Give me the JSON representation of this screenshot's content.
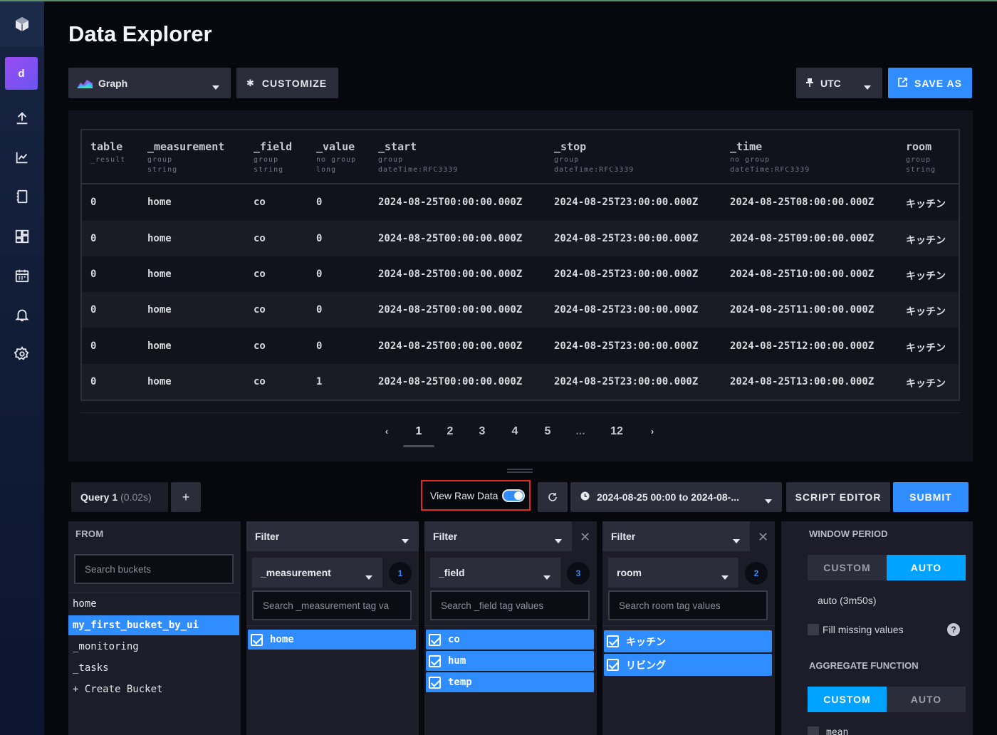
{
  "page": {
    "title": "Data Explorer"
  },
  "sidebar": {
    "org_initial": "d",
    "icons": [
      "upload-icon",
      "chart-icon",
      "notebook-icon",
      "dashboards-icon",
      "tasks-calendar-icon",
      "alerts-bell-icon",
      "settings-gear-icon"
    ]
  },
  "toolbar": {
    "graph_label": "Graph",
    "customize_label": "CUSTOMIZE",
    "timezone_label": "UTC",
    "save_as_label": "SAVE AS"
  },
  "table": {
    "columns": [
      {
        "name": "table",
        "sub1": "_result",
        "sub2": ""
      },
      {
        "name": "_measurement",
        "sub1": "group",
        "sub2": "string"
      },
      {
        "name": "_field",
        "sub1": "group",
        "sub2": "string"
      },
      {
        "name": "_value",
        "sub1": "no group",
        "sub2": "long"
      },
      {
        "name": "_start",
        "sub1": "group",
        "sub2": "dateTime:RFC3339"
      },
      {
        "name": "_stop",
        "sub1": "group",
        "sub2": "dateTime:RFC3339"
      },
      {
        "name": "_time",
        "sub1": "no group",
        "sub2": "dateTime:RFC3339"
      },
      {
        "name": "room",
        "sub1": "group",
        "sub2": "string"
      }
    ],
    "rows": [
      [
        "0",
        "home",
        "co",
        "0",
        "2024-08-25T00:00:00.000Z",
        "2024-08-25T23:00:00.000Z",
        "2024-08-25T08:00:00.000Z",
        "キッチン"
      ],
      [
        "0",
        "home",
        "co",
        "0",
        "2024-08-25T00:00:00.000Z",
        "2024-08-25T23:00:00.000Z",
        "2024-08-25T09:00:00.000Z",
        "キッチン"
      ],
      [
        "0",
        "home",
        "co",
        "0",
        "2024-08-25T00:00:00.000Z",
        "2024-08-25T23:00:00.000Z",
        "2024-08-25T10:00:00.000Z",
        "キッチン"
      ],
      [
        "0",
        "home",
        "co",
        "0",
        "2024-08-25T00:00:00.000Z",
        "2024-08-25T23:00:00.000Z",
        "2024-08-25T11:00:00.000Z",
        "キッチン"
      ],
      [
        "0",
        "home",
        "co",
        "0",
        "2024-08-25T00:00:00.000Z",
        "2024-08-25T23:00:00.000Z",
        "2024-08-25T12:00:00.000Z",
        "キッチン"
      ],
      [
        "0",
        "home",
        "co",
        "1",
        "2024-08-25T00:00:00.000Z",
        "2024-08-25T23:00:00.000Z",
        "2024-08-25T13:00:00.000Z",
        "キッチン"
      ]
    ]
  },
  "pagination": {
    "prev": "‹",
    "pages": [
      "1",
      "2",
      "3",
      "4",
      "5"
    ],
    "ellipsis": "...",
    "last": "12",
    "next": "›",
    "current": "1"
  },
  "query_bar": {
    "query_tab_label": "Query 1",
    "query_tab_time": "(0.02s)",
    "add_query": "+",
    "view_raw_label": "View Raw Data",
    "view_raw_on": true,
    "time_range": "2024-08-25 00:00 to 2024-08-...",
    "script_editor_label": "SCRIPT EDITOR",
    "submit_label": "SUBMIT"
  },
  "from": {
    "title": "FROM",
    "search_placeholder": "Search buckets",
    "buckets": [
      "home",
      "my_first_bucket_by_ui",
      "_monitoring",
      "_tasks",
      "+ Create Bucket"
    ],
    "selected_bucket": "my_first_bucket_by_ui"
  },
  "filters": [
    {
      "head": "Filter",
      "key": "_measurement",
      "count": "1",
      "search_placeholder": "Search _measurement tag va",
      "values": [
        "home"
      ]
    },
    {
      "head": "Filter",
      "key": "_field",
      "count": "3",
      "search_placeholder": "Search _field tag values",
      "values": [
        "co",
        "hum",
        "temp"
      ]
    },
    {
      "head": "Filter",
      "key": "room",
      "count": "2",
      "search_placeholder": "Search room tag values",
      "values": [
        "キッチン",
        "リビング"
      ]
    }
  ],
  "window": {
    "title": "WINDOW PERIOD",
    "custom_label": "CUSTOM",
    "auto_label": "AUTO",
    "auto_value": "auto (3m50s)",
    "fill_missing_label": "Fill missing values",
    "help": "?"
  },
  "aggregate": {
    "title": "AGGREGATE FUNCTION",
    "custom_label": "CUSTOM",
    "auto_label": "AUTO",
    "first_function": "mean"
  },
  "colors": {
    "accent": "#2f8dff",
    "selection": "#00a3ff",
    "highlight_border": "#e22b20"
  }
}
